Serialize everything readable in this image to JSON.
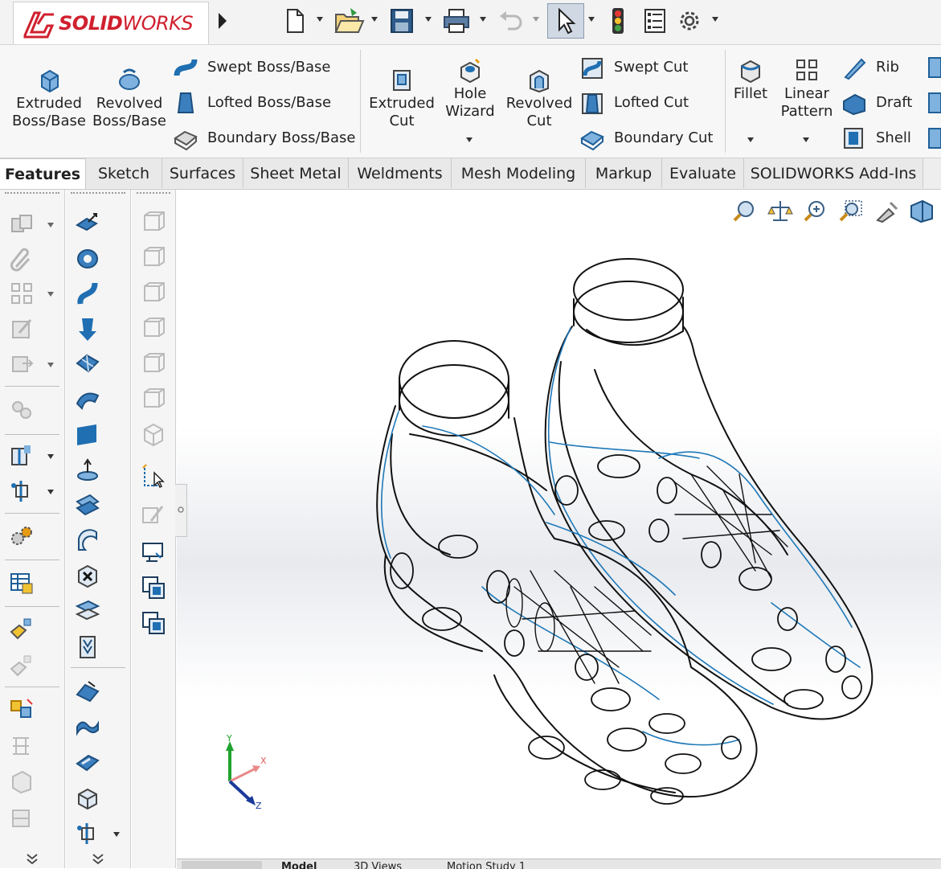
{
  "app": {
    "logo_brand_bold": "SOLID",
    "logo_brand_light": "WORKS"
  },
  "quick_access": {
    "icons": [
      "new-document-icon",
      "open-folder-icon",
      "save-icon",
      "print-icon",
      "undo-icon",
      "select-pointer-icon",
      "rebuild-traffic-light-icon",
      "file-properties-icon",
      "options-gear-icon"
    ]
  },
  "ribbon": {
    "extruded_boss": "Extruded\nBoss/Base",
    "revolved_boss": "Revolved\nBoss/Base",
    "swept_boss": "Swept Boss/Base",
    "lofted_boss": "Lofted Boss/Base",
    "boundary_boss": "Boundary Boss/Base",
    "extruded_cut": "Extruded\nCut",
    "hole_wizard": "Hole\nWizard",
    "revolved_cut": "Revolved\nCut",
    "swept_cut": "Swept Cut",
    "lofted_cut": "Lofted Cut",
    "boundary_cut": "Boundary Cut",
    "fillet": "Fillet",
    "linear_pattern": "Linear\nPattern",
    "rib": "Rib",
    "draft": "Draft",
    "shell": "Shell"
  },
  "tabs": [
    {
      "label": "Features",
      "active": true
    },
    {
      "label": "Sketch",
      "active": false
    },
    {
      "label": "Surfaces",
      "active": false
    },
    {
      "label": "Sheet Metal",
      "active": false
    },
    {
      "label": "Weldments",
      "active": false
    },
    {
      "label": "Mesh Modeling",
      "active": false
    },
    {
      "label": "Markup",
      "active": false
    },
    {
      "label": "Evaluate",
      "active": false
    },
    {
      "label": "SOLIDWORKS Add-Ins",
      "active": false
    }
  ],
  "heads_up_toolbar": [
    "zoom-to-fit-icon",
    "measure-balance-icon",
    "zoom-area-icon",
    "zoom-selection-icon",
    "pan-flashlight-icon",
    "view-orientation-icon"
  ],
  "triad": {
    "y_label": "Y",
    "x_label": "X",
    "z_label": "Z"
  },
  "bottom_tabs": [
    {
      "label": "Model"
    },
    {
      "label": "3D Views"
    },
    {
      "label": "Motion Study 1"
    }
  ],
  "colors": {
    "brand_red": "#d0202e",
    "icon_blue": "#1f6fb2",
    "model_edge_dark": "#111111",
    "model_edge_blue": "#1e78b8"
  }
}
